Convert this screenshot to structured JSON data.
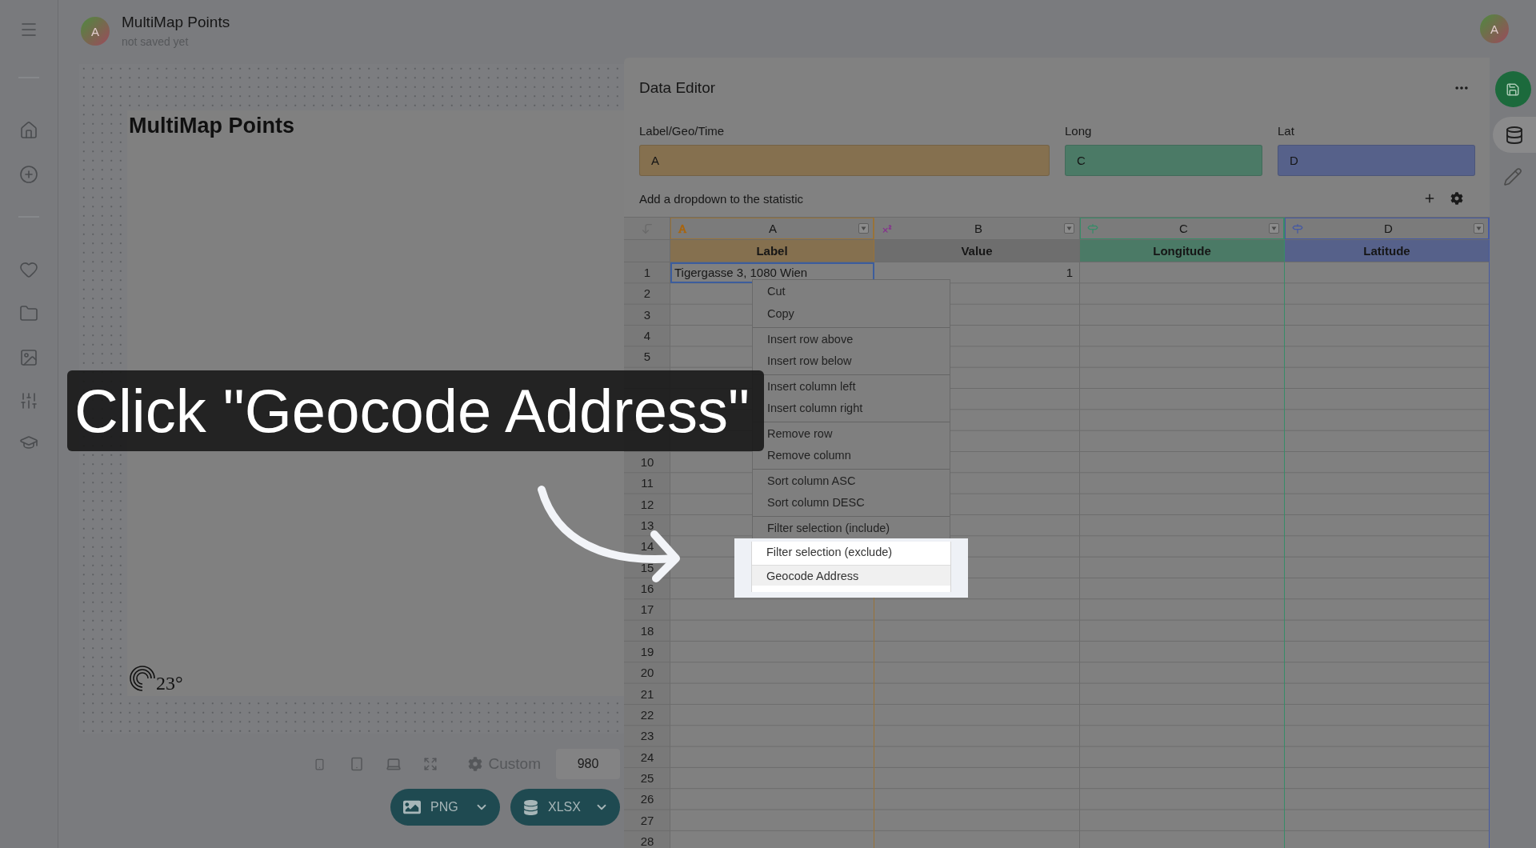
{
  "app_header": {
    "avatar_initial": "A",
    "title": "MultiMap Points",
    "subtitle": "not saved yet",
    "user_initial": "A"
  },
  "canvas": {
    "title": "MultiMap Points",
    "logo_text": "23°"
  },
  "preview_toolbar": {
    "size_preset": "Custom",
    "width_value": "980"
  },
  "export_buttons": [
    {
      "label": "PNG",
      "kind": "image"
    },
    {
      "label": "XLSX",
      "kind": "data"
    }
  ],
  "data_editor": {
    "title": "Data Editor",
    "mappings": [
      {
        "label": "Label/Geo/Time",
        "value": "A",
        "color": "#85704f"
      },
      {
        "label": "Long",
        "value": "C",
        "color": "#4b7a66"
      },
      {
        "label": "Lat",
        "value": "D",
        "color": "#56618a"
      }
    ],
    "dropdown_hint": "Add a dropdown to the statistic",
    "sheet": {
      "columns": [
        {
          "letter": "A",
          "kind": "text",
          "heading": "Label",
          "color": "#85704f"
        },
        {
          "letter": "B",
          "kind": "number",
          "heading": "Value"
        },
        {
          "letter": "C",
          "kind": "geo",
          "heading": "Longitude",
          "color": "#4b7a66"
        },
        {
          "letter": "D",
          "kind": "geo",
          "heading": "Latitude",
          "color": "#56618a"
        }
      ],
      "rows": [
        {
          "number": "1",
          "cells": [
            {
              "text": "Tigergasse 3, 1080 Wien",
              "selected": true
            },
            {
              "text": "1",
              "selected": false
            }
          ]
        },
        {
          "number": "2"
        },
        {
          "number": "3"
        },
        {
          "number": "4"
        },
        {
          "number": "5"
        },
        {},
        {},
        {},
        {},
        {
          "number": "10"
        },
        {
          "number": "11"
        },
        {
          "number": "12"
        },
        {
          "number": "13"
        },
        {
          "number": "14"
        },
        {
          "number": "15"
        },
        {
          "number": "16"
        },
        {
          "number": "17"
        },
        {
          "number": "18"
        },
        {
          "number": "19"
        },
        {
          "number": "20"
        },
        {
          "number": "21"
        },
        {
          "number": "22"
        },
        {
          "number": "23"
        },
        {
          "number": "24"
        },
        {
          "number": "25"
        },
        {
          "number": "26"
        },
        {
          "number": "27"
        },
        {
          "number": "28"
        }
      ]
    }
  },
  "context_menu": {
    "items": [
      {
        "label": "Cut",
        "divider_before": false,
        "selected": false,
        "spotlit": false
      },
      {
        "label": "Copy",
        "divider_before": false,
        "selected": false,
        "spotlit": false
      },
      {
        "label": "Insert row above",
        "divider_before": true,
        "selected": false,
        "spotlit": false
      },
      {
        "label": "Insert row below",
        "divider_before": false,
        "selected": false,
        "spotlit": false
      },
      {
        "label": "Insert column left",
        "divider_before": true,
        "selected": false,
        "spotlit": false
      },
      {
        "label": "Insert column right",
        "divider_before": false,
        "selected": false,
        "spotlit": false
      },
      {
        "label": "Remove row",
        "divider_before": true,
        "selected": false,
        "spotlit": false
      },
      {
        "label": "Remove column",
        "divider_before": false,
        "selected": false,
        "spotlit": false
      },
      {
        "label": "Sort column ASC",
        "divider_before": true,
        "selected": false,
        "spotlit": false
      },
      {
        "label": "Sort column DESC",
        "divider_before": false,
        "selected": false,
        "spotlit": false
      },
      {
        "label": "Filter selection (include)",
        "divider_before": true,
        "selected": false,
        "spotlit": false
      },
      {
        "label": "Filter selection (exclude)",
        "divider_before": false,
        "selected": false,
        "spotlit": true
      },
      {
        "label": "Geocode Address",
        "divider_before": true,
        "selected": true,
        "spotlit": true
      }
    ]
  },
  "tutorial": {
    "caption": "Click \"Geocode Address\""
  }
}
